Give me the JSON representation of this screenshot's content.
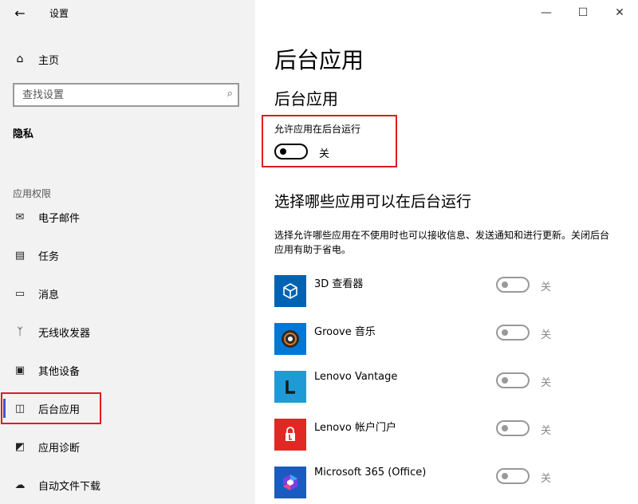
{
  "window": {
    "title": "设置",
    "back_icon": "back-arrow-icon",
    "controls": {
      "minimize": "—",
      "maximize": "☐",
      "close": "✕"
    }
  },
  "sidebar": {
    "home_label": "主页",
    "search_placeholder": "查找设置",
    "section_title": "隐私",
    "group_label": "应用权限",
    "items": [
      {
        "label": "电子邮件",
        "icon": "mail-icon"
      },
      {
        "label": "任务",
        "icon": "clipboard-icon"
      },
      {
        "label": "消息",
        "icon": "message-icon"
      },
      {
        "label": "无线收发器",
        "icon": "radio-icon"
      },
      {
        "label": "其他设备",
        "icon": "devices-icon"
      },
      {
        "label": "后台应用",
        "icon": "background-apps-icon",
        "selected": true
      },
      {
        "label": "应用诊断",
        "icon": "diagnostics-icon"
      },
      {
        "label": "自动文件下载",
        "icon": "cloud-download-icon"
      }
    ]
  },
  "main": {
    "page_title": "后台应用",
    "section1_title": "后台应用",
    "allow_label": "允许应用在后台运行",
    "allow_state": "关",
    "section2_title": "选择哪些应用可以在后台运行",
    "description": "选择允许哪些应用在不使用时也可以接收信息、发送通知和进行更新。关闭后台应用有助于省电。",
    "apps": [
      {
        "name": "3D 查看器",
        "state": "关",
        "color": "#0063b1"
      },
      {
        "name": "Groove 音乐",
        "state": "关",
        "color": "#0078d7"
      },
      {
        "name": "Lenovo Vantage",
        "state": "关",
        "color": "#1e9bd7"
      },
      {
        "name": "Lenovo 帐户门户",
        "state": "关",
        "color": "#e12825"
      },
      {
        "name": "Microsoft 365 (Office)",
        "state": "关",
        "color": "#1a5bbf"
      }
    ]
  },
  "colors": {
    "highlight": "#e11b22",
    "accent": "#3a5bcc"
  }
}
